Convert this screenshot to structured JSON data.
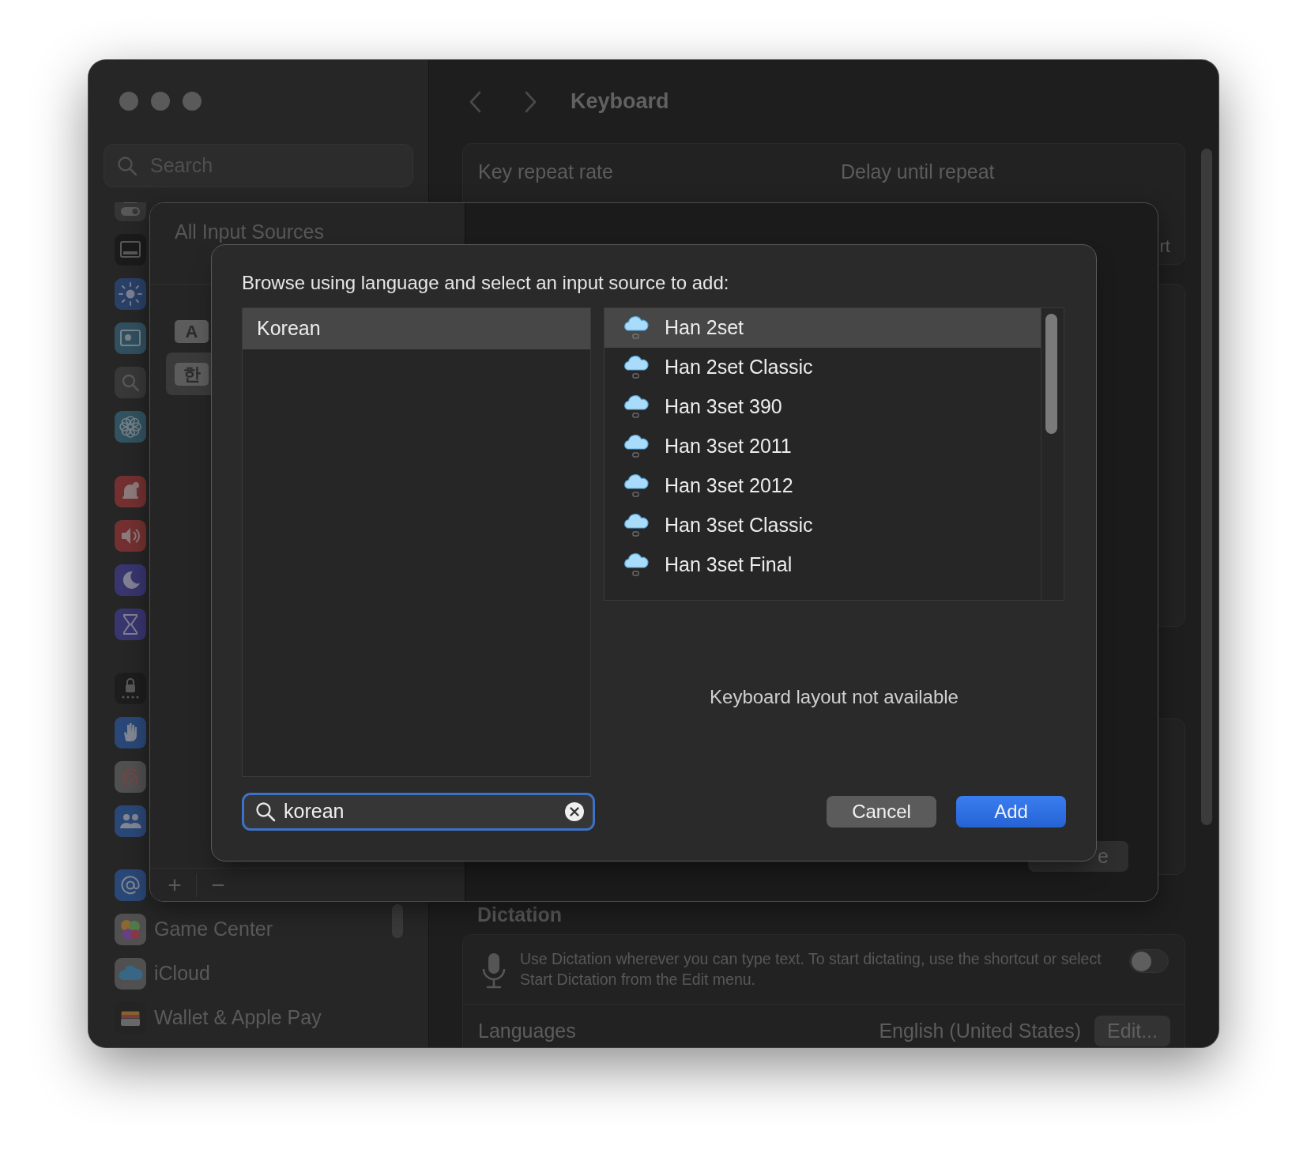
{
  "window": {
    "title": "Keyboard"
  },
  "sidebar": {
    "search": {
      "placeholder": "Search"
    },
    "items": [
      {
        "label": "Game Center"
      },
      {
        "label": "iCloud"
      },
      {
        "label": "Wallet & Apple Pay"
      }
    ]
  },
  "keyboard": {
    "key_repeat_label": "Key repeat rate",
    "delay_label": "Delay until repeat",
    "partial_label": "rt",
    "dictation_heading": "Dictation",
    "dictation_text": "Use Dictation wherever you can type text. To start dictating, use the shortcut or select Start Dictation from the Edit menu.",
    "dictation_on": false,
    "languages_label": "Languages",
    "languages_value": "English (United States)",
    "edit_button": "Edit..."
  },
  "input_sources_sheet": {
    "title": "All Input Sources",
    "sources": [
      {
        "glyph": "A",
        "selected": false
      },
      {
        "glyph": "한",
        "selected": true
      }
    ],
    "add_button": "+",
    "remove_button": "−",
    "partial_button": "e"
  },
  "add_sheet": {
    "prompt": "Browse using language and select an input source to add:",
    "languages": [
      {
        "label": "Korean",
        "selected": true
      }
    ],
    "sources": [
      {
        "label": "Han 2set",
        "selected": true
      },
      {
        "label": "Han 2set Classic",
        "selected": false
      },
      {
        "label": "Han 3set 390",
        "selected": false
      },
      {
        "label": "Han 3set 2011",
        "selected": false
      },
      {
        "label": "Han 3set 2012",
        "selected": false
      },
      {
        "label": "Han 3set Classic",
        "selected": false
      },
      {
        "label": "Han 3set Final",
        "selected": false
      }
    ],
    "empty_text": "Keyboard layout not available",
    "search": {
      "value": "korean"
    },
    "buttons": [
      {
        "label": "Cancel",
        "kind": "secondary"
      },
      {
        "label": "Add",
        "kind": "default"
      }
    ]
  }
}
